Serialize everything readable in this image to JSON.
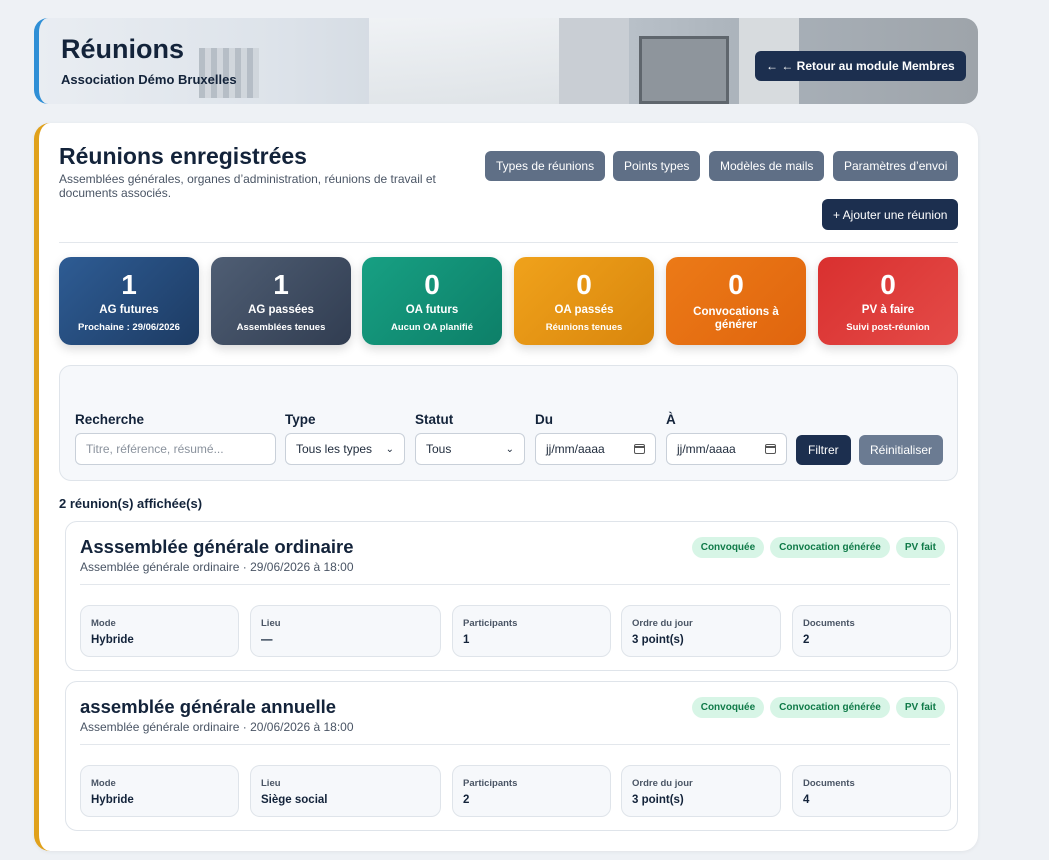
{
  "header": {
    "title": "Réunions",
    "subtitle": "Association Démo Bruxelles",
    "back_button": "← ← Retour au module Membres"
  },
  "main": {
    "title": "Réunions enregistrées",
    "description": "Assemblées générales, organes d’administration, réunions de travail et documents associés.",
    "toolbar": {
      "types": "Types de réunions",
      "points": "Points types",
      "mails": "Modèles de mails",
      "settings": "Paramètres d’envoi",
      "add": "+ Ajouter une réunion"
    }
  },
  "stats": [
    {
      "value": "1",
      "label": "AG futures",
      "sub": "Prochaine : 29/06/2026",
      "color": "#244b7c"
    },
    {
      "value": "1",
      "label": "AG passées",
      "sub": "Assemblées tenues",
      "color": "#3f4c61"
    },
    {
      "value": "0",
      "label": "OA futurs",
      "sub": "Aucun OA planifié",
      "color": "#129075"
    },
    {
      "value": "0",
      "label": "OA passés",
      "sub": "Réunions tenues",
      "color": "#e59414"
    },
    {
      "value": "0",
      "label": "Convocations à générer",
      "sub": "",
      "color": "#e66f12"
    },
    {
      "value": "0",
      "label": "PV à faire",
      "sub": "Suivi post-réunion",
      "color": "#de3c3b"
    }
  ],
  "filters": {
    "search_label": "Recherche",
    "search_placeholder": "Titre, référence, résumé...",
    "type_label": "Type",
    "type_value": "Tous les types",
    "status_label": "Statut",
    "status_value": "Tous",
    "from_label": "Du",
    "from_value": "jj/mm/aaaa",
    "to_label": "À",
    "to_value": "jj/mm/aaaa",
    "filter_button": "Filtrer",
    "reset_button": "Réinitialiser"
  },
  "results_count": "2 réunion(s) affichée(s)",
  "meetings": [
    {
      "title": "Asssemblée générale ordinaire",
      "subtitle": "Assemblée générale ordinaire · 29/06/2026 à 18:00",
      "badges": [
        "Convoquée",
        "Convocation générée",
        "PV fait"
      ],
      "fields": [
        {
          "key": "Mode",
          "value": "Hybride"
        },
        {
          "key": "Lieu",
          "value": "—"
        },
        {
          "key": "Participants",
          "value": "1"
        },
        {
          "key": "Ordre du jour",
          "value": "3 point(s)"
        },
        {
          "key": "Documents",
          "value": "2"
        }
      ]
    },
    {
      "title": "assemblée générale annuelle",
      "subtitle": "Assemblée générale ordinaire · 20/06/2026 à 18:00",
      "badges": [
        "Convoquée",
        "Convocation générée",
        "PV fait"
      ],
      "fields": [
        {
          "key": "Mode",
          "value": "Hybride"
        },
        {
          "key": "Lieu",
          "value": "Siège social"
        },
        {
          "key": "Participants",
          "value": "2"
        },
        {
          "key": "Ordre du jour",
          "value": "3 point(s)"
        },
        {
          "key": "Documents",
          "value": "4"
        }
      ]
    }
  ]
}
